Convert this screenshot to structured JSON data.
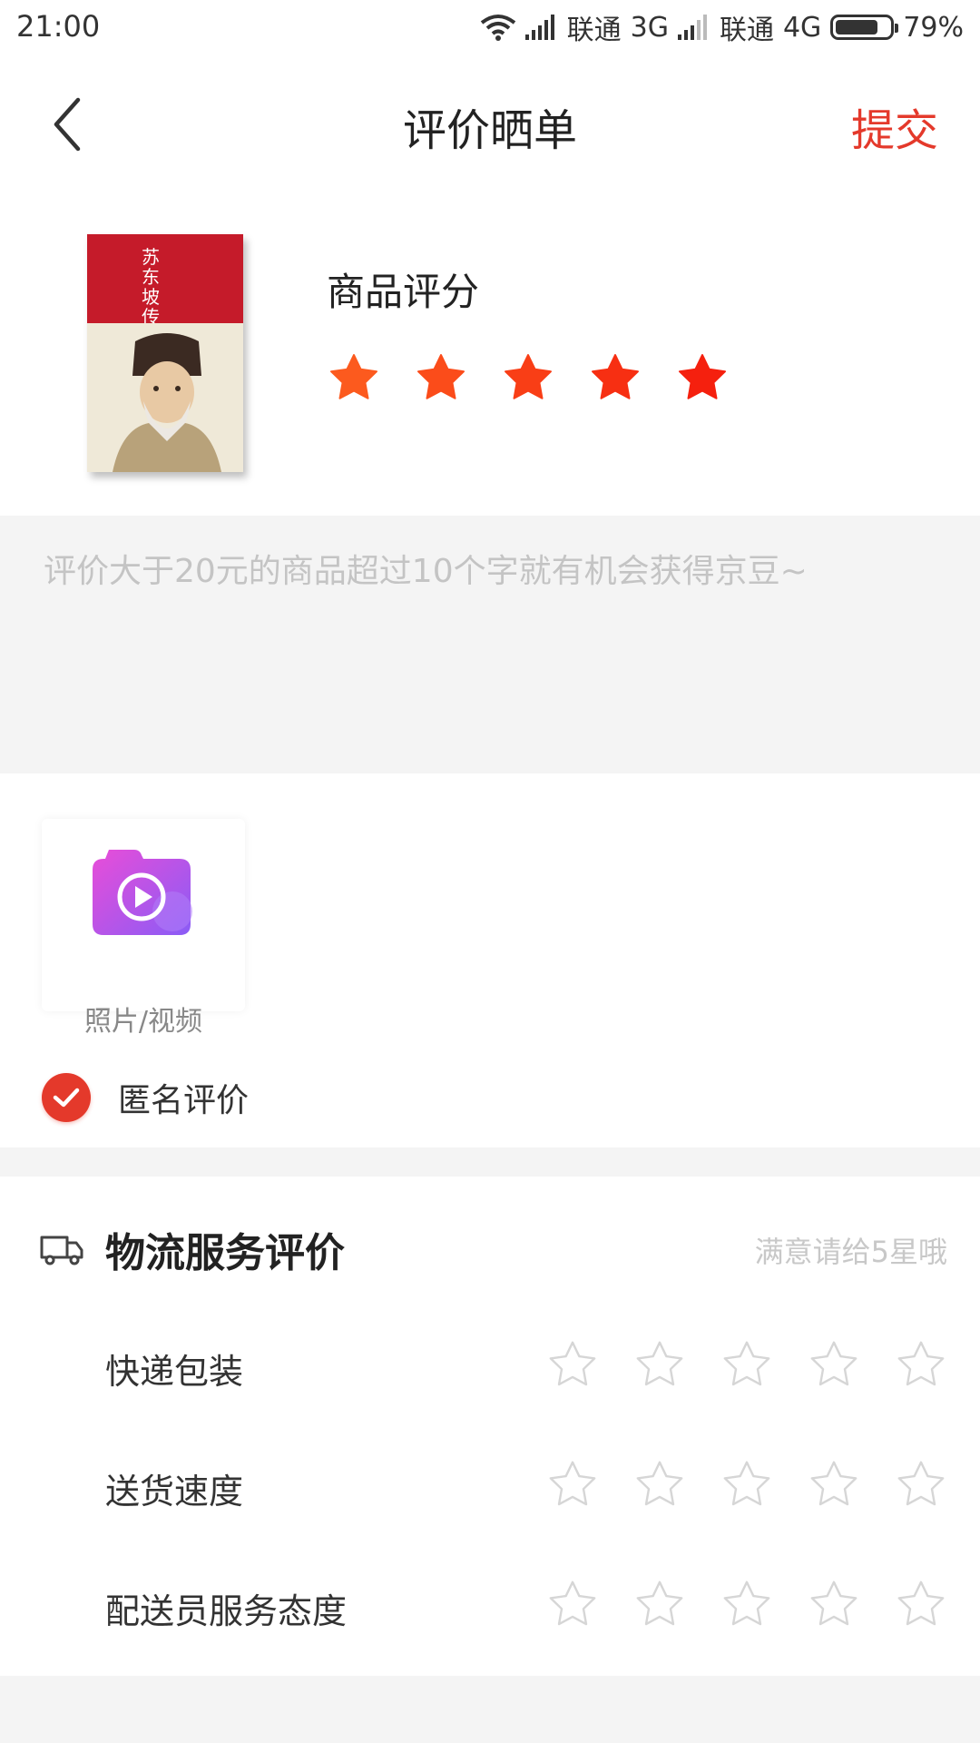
{
  "status_bar": {
    "time": "21:00",
    "carrier1": "联通",
    "net1": "3G",
    "carrier2": "联通",
    "net2": "4G",
    "battery": "79%",
    "battery_level": 0.79
  },
  "header": {
    "title": "评价晒单",
    "submit_label": "提交",
    "back_icon": "chevron-left-icon"
  },
  "product": {
    "cover_title": "苏东坡传",
    "rating_title": "商品评分",
    "rating_value": 5,
    "rating_max": 5,
    "star_colors": [
      "#fc5a1e",
      "#fb4c1a",
      "#f93e16",
      "#f72f12",
      "#f5200e"
    ]
  },
  "comment": {
    "placeholder": "评价大于20元的商品超过10个字就有机会获得京豆~",
    "value": ""
  },
  "media": {
    "upload_label": "照片/视频",
    "upload_icon": "camera-video-icon"
  },
  "anonymous": {
    "label": "匿名评价",
    "checked": true
  },
  "logistics": {
    "title": "物流服务评价",
    "hint": "满意请给5星哦",
    "icon": "truck-icon",
    "rows": [
      {
        "label": "快递包装",
        "value": 0
      },
      {
        "label": "送货速度",
        "value": 0
      },
      {
        "label": "配送员服务态度",
        "value": 0
      }
    ],
    "max": 5
  },
  "colors": {
    "accent": "#e4392b",
    "placeholder": "#c4c4c4",
    "background": "#f4f4f4"
  }
}
